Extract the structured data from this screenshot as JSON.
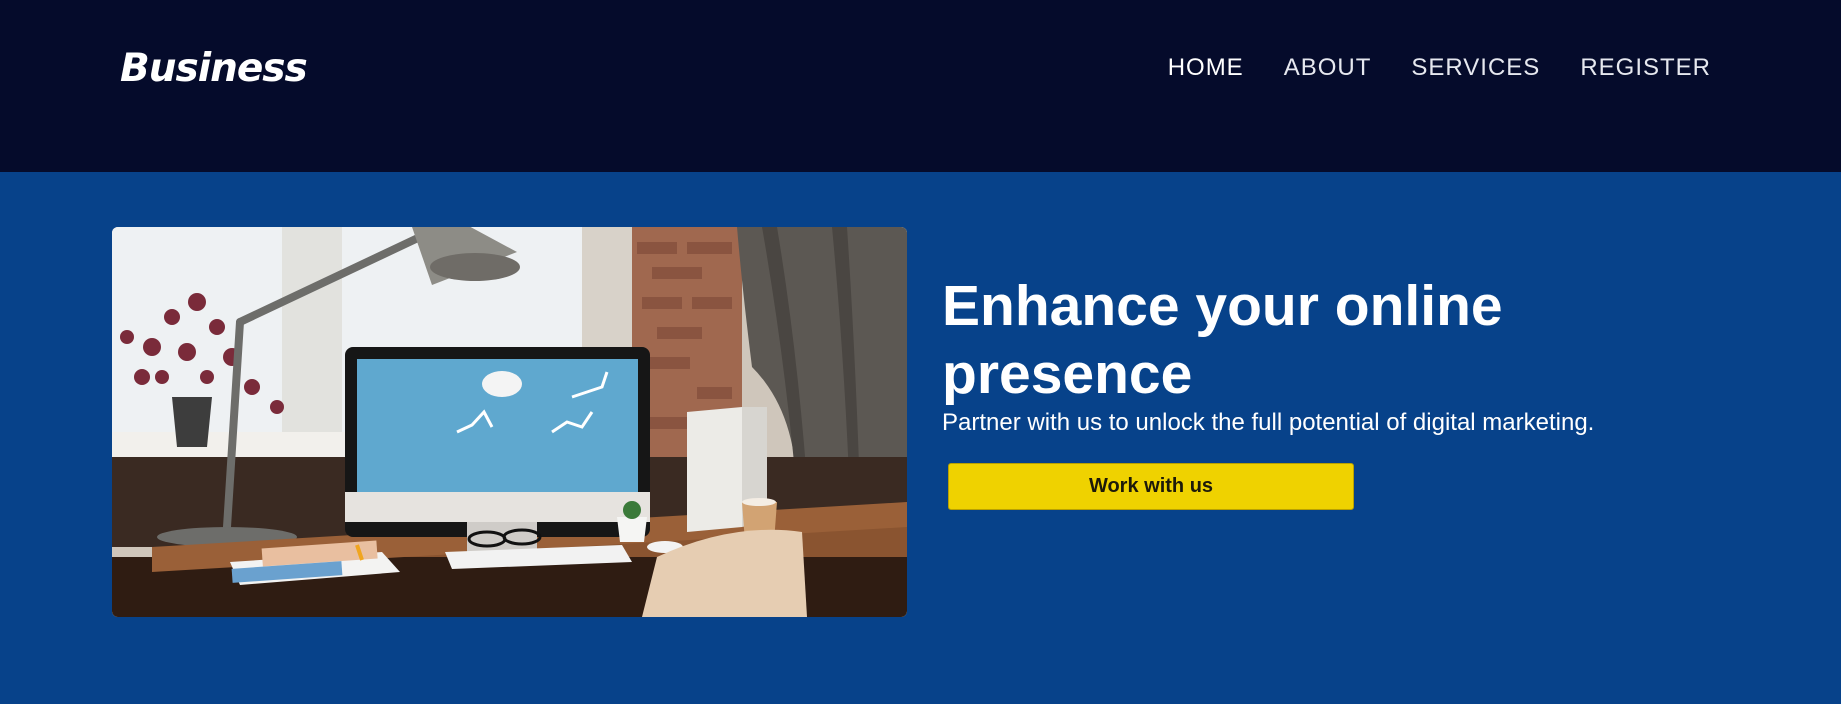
{
  "header": {
    "brand": "Business",
    "nav": [
      {
        "label": "HOME"
      },
      {
        "label": "ABOUT"
      },
      {
        "label": "SERVICES"
      },
      {
        "label": "REGISTER"
      }
    ]
  },
  "hero": {
    "image": "office-desk-computer-photo",
    "title": "Enhance your online presence",
    "subtitle": "Partner with us to unlock the full potential of digital marketing.",
    "cta_label": "Work with us"
  },
  "colors": {
    "navbar_bg": "#050b2b",
    "hero_bg": "#07428a",
    "cta_bg": "#efd200"
  }
}
